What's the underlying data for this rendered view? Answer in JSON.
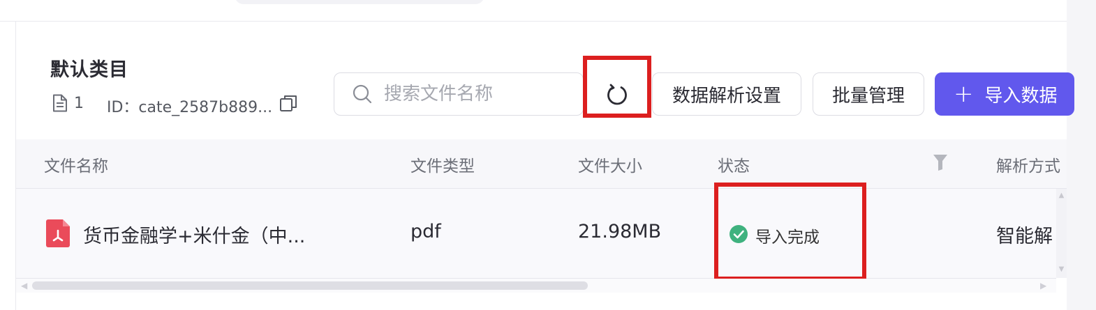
{
  "category": {
    "title": "默认类目",
    "file_count": "1",
    "id_text": "ID：cate_2587b889..."
  },
  "search": {
    "placeholder": "搜索文件名称"
  },
  "toolbar": {
    "parse_settings_label": "数据解析设置",
    "batch_manage_label": "批量管理",
    "import_plus": "+",
    "import_label": "导入数据"
  },
  "table": {
    "columns": [
      "文件名称",
      "文件类型",
      "文件大小",
      "状态",
      "解析方式"
    ],
    "rows": [
      {
        "name": "货币金融学+米什金（中...",
        "type": "pdf",
        "size": "21.98MB",
        "status": "导入完成",
        "parse_method": "智能解"
      }
    ]
  },
  "colors": {
    "primary": "#6158ed",
    "highlight": "#dc1f1f",
    "success": "#3fb27f",
    "pdf": "#ea4b5a"
  },
  "icons": [
    "document-icon",
    "copy-icon",
    "search-icon",
    "refresh-icon",
    "plus-icon",
    "filter-icon",
    "pdf-file-icon",
    "check-circle-icon"
  ]
}
